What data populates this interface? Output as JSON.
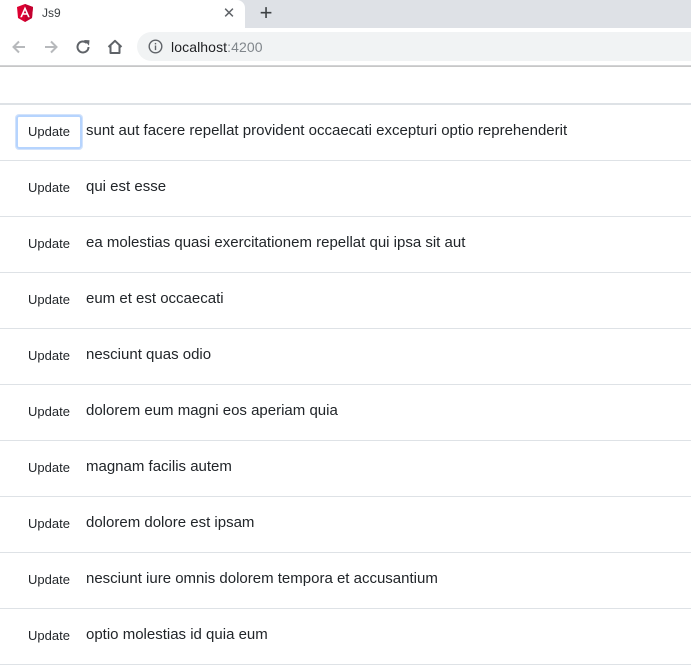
{
  "browser": {
    "tab_title": "Js9",
    "tab_close": "✕",
    "new_tab": "+",
    "url_host": "localhost",
    "url_port": ":4200",
    "favicon": "angular-icon",
    "colors": {
      "tabstrip": "#dee1e6",
      "omnibox": "#f1f3f4",
      "angular_red": "#dd0031"
    }
  },
  "list": {
    "button_label": "Update",
    "items": [
      {
        "title": "sunt aut facere repellat provident occaecati excepturi optio reprehenderit",
        "focused": true
      },
      {
        "title": "qui est esse",
        "focused": false
      },
      {
        "title": "ea molestias quasi exercitationem repellat qui ipsa sit aut",
        "focused": false
      },
      {
        "title": "eum et est occaecati",
        "focused": false
      },
      {
        "title": "nesciunt quas odio",
        "focused": false
      },
      {
        "title": "dolorem eum magni eos aperiam quia",
        "focused": false
      },
      {
        "title": "magnam facilis autem",
        "focused": false
      },
      {
        "title": "dolorem dolore est ipsam",
        "focused": false
      },
      {
        "title": "nesciunt iure omnis dolorem tempora et accusantium",
        "focused": false
      },
      {
        "title": "optio molestias id quia eum",
        "focused": false
      }
    ]
  }
}
